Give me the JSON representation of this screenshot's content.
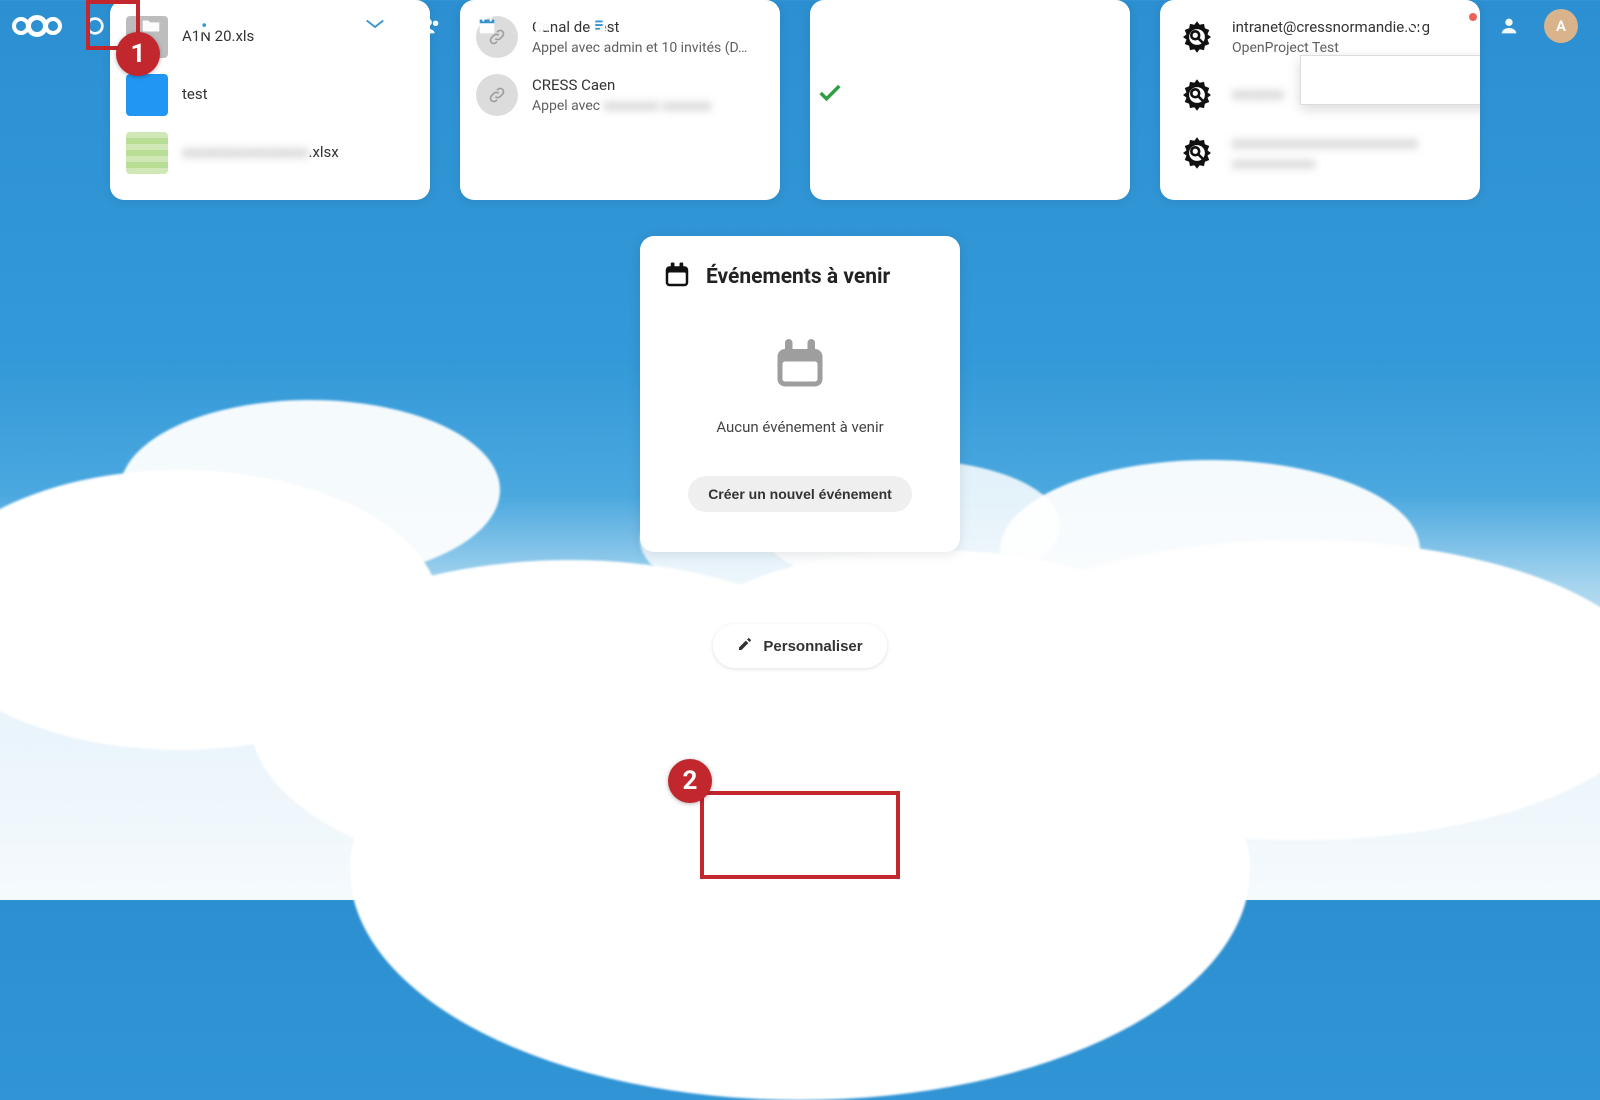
{
  "avatar_letter": "A",
  "recent_files": {
    "items": [
      {
        "name": "A1N   20.xls",
        "thumb": "folder-grey"
      },
      {
        "name": "test",
        "thumb": "blue"
      },
      {
        "name_blur": "xxxxxxxxxxxxxxxxx",
        "ext": ".xlsx",
        "thumb": "sheet"
      }
    ]
  },
  "talk": {
    "items": [
      {
        "title": "Canal de test",
        "sub": "Appel avec admin et 10 invités (D…",
        "icon": "link"
      },
      {
        "title": "CRESS Caen",
        "sub_prefix": "Appel avec ",
        "sub_blur": "xxxxxxxx xxxxxxx",
        "icon": "link"
      }
    ]
  },
  "openproject": {
    "items": [
      {
        "title": "intranet@cressnormandie.org",
        "sub": "OpenProject Test"
      },
      {
        "title_blur": "xxxxxxx",
        "sub_blur": ""
      },
      {
        "title_blur": "xxxxxxxxxxxxxxxxxxxxxxxxx",
        "sub_blur": "xxxxxxxxxxxx"
      }
    ]
  },
  "events": {
    "title": "Événements à venir",
    "empty": "Aucun événement à venir",
    "create_label": "Créer un nouvel événement"
  },
  "personalize_label": "Personnaliser",
  "annotations": {
    "1": "1",
    "2": "2"
  }
}
